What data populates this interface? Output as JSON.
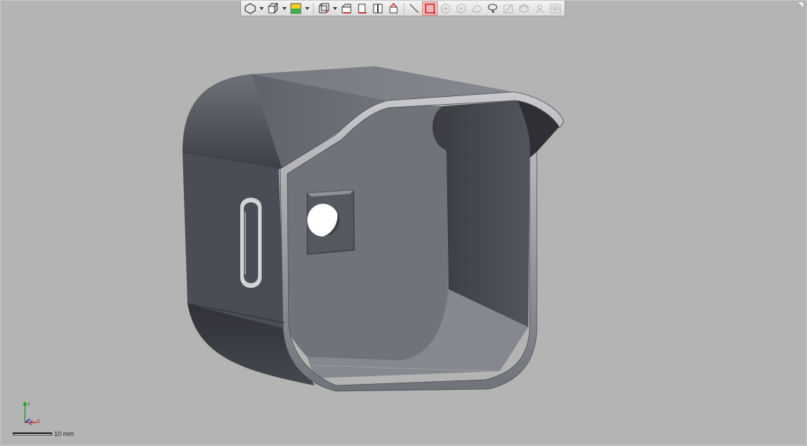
{
  "toolbar": {
    "items": [
      {
        "name": "view-orientation-button",
        "icon": "cube-hexagon-icon",
        "dropdown": true
      },
      {
        "name": "display-style-button",
        "icon": "shaded-cube-icon",
        "dropdown": true
      },
      {
        "name": "appearance-button",
        "icon": "color-square-icon",
        "dropdown": true
      },
      {
        "name": "section-view-button",
        "icon": "section-box-icon",
        "dropdown": true
      },
      {
        "name": "front-view-button",
        "icon": "front-face-icon",
        "dropdown": false
      },
      {
        "name": "side-view-button",
        "icon": "side-face-icon",
        "dropdown": false
      },
      {
        "name": "split-view-button",
        "icon": "split-panel-icon",
        "dropdown": false
      },
      {
        "name": "measure-button",
        "icon": "measure-icon",
        "dropdown": false
      },
      {
        "name": "line-tool-button",
        "icon": "line-icon",
        "dropdown": false
      },
      {
        "name": "box-select-button",
        "icon": "box-select-icon",
        "dropdown": false,
        "active": true
      },
      {
        "name": "point-tool-button",
        "icon": "circle-plus-icon",
        "dropdown": false,
        "disabled": true
      },
      {
        "name": "center-tool-button",
        "icon": "circle-target-icon",
        "dropdown": false,
        "disabled": true
      },
      {
        "name": "curve-tool-button",
        "icon": "curve-icon",
        "dropdown": false,
        "disabled": true
      },
      {
        "name": "lasso-select-button",
        "icon": "lasso-icon",
        "dropdown": false
      },
      {
        "name": "markup-button",
        "icon": "markup-pen-icon",
        "dropdown": false,
        "disabled": true
      },
      {
        "name": "rotate-view-button",
        "icon": "rotate-cube-icon",
        "dropdown": false,
        "disabled": true
      },
      {
        "name": "explode-button",
        "icon": "explode-icon",
        "dropdown": false,
        "disabled": true
      },
      {
        "name": "visibility-button",
        "icon": "eye-icon",
        "dropdown": false,
        "disabled": true
      }
    ]
  },
  "triad": {
    "x_label": "X",
    "y_label": "Y",
    "z_label": "Z"
  },
  "scale": {
    "label": "10 mm"
  },
  "colors": {
    "background": "#b4b4b4",
    "model_dark": "#3c3e45",
    "model_mid": "#5b5e66",
    "model_light": "#7c7f87",
    "accent_active": "#f2b8b8",
    "accent_red": "#d83030"
  }
}
